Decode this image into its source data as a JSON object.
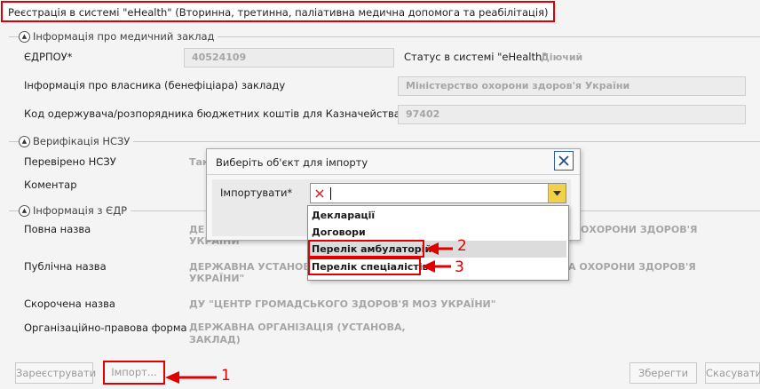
{
  "window": {
    "title": "Реєстрація в системі \"eHealth\" (Вторинна, третинна, паліативна медична допомога та реабілітація)"
  },
  "sections": {
    "medical": {
      "header": "Інформація про медичний заклад",
      "edrpou_label": "ЄДРПОУ*",
      "edrpou_value": "40524109",
      "status_label": "Статус в системі \"eHealth\"",
      "status_value": "Діючий",
      "owner_label": "Інформація про власника (бенефіціара) закладу",
      "owner_value": "Міністерство охорони здоров'я України",
      "treasury_label": "Код одержувача/розпорядника бюджетних коштів для Казначейства",
      "treasury_value": "97402"
    },
    "nszu": {
      "header": "Верифікація НСЗУ",
      "verified_label": "Перевірено НСЗУ",
      "verified_value": "Так",
      "comment_label": "Коментар"
    },
    "edr": {
      "header": "Інформація з ЄДР",
      "full_name_label": "Повна назва",
      "full_name_start": "ДЕ",
      "full_name_line2": "УКРАЇНИ\"",
      "full_name_end": "ОХОРОНИ ЗДОРОВ'Я",
      "public_name_label": "Публічна назва",
      "public_name_start": "ДЕРЖАВНА УСТАНОВА",
      "public_name_end": "А ОХОРОНИ ЗДОРОВ'Я",
      "public_name_line2": "УКРАЇНИ\"",
      "short_name_label": "Скорочена назва",
      "short_name_value": "ДУ \"ЦЕНТР ГРОМАДСЬКОГО ЗДОРОВ'Я МОЗ УКРАЇНИ\"",
      "legal_form_label": "Організаційно-правова форма",
      "legal_form_line1": "ДЕРЖАВНА ОРГАНІЗАЦІЯ (УСТАНОВА,",
      "legal_form_line2": "ЗАКЛАД)"
    }
  },
  "buttons": {
    "register": "Зареєструвати",
    "import": "Імпорт...",
    "save": "Зберегти",
    "cancel": "Скасувати"
  },
  "dialog": {
    "title": "Виберіть об'єкт для імпорту",
    "import_label": "Імпортувати*",
    "options": [
      "Декларації",
      "Договори",
      "Перелік амбулаторій",
      "Перелік спеціалістів"
    ],
    "highlighted_option": "Перелік амбулаторій"
  },
  "annotations": {
    "one": "1",
    "two": "2",
    "three": "3",
    "color": "#e00000"
  }
}
